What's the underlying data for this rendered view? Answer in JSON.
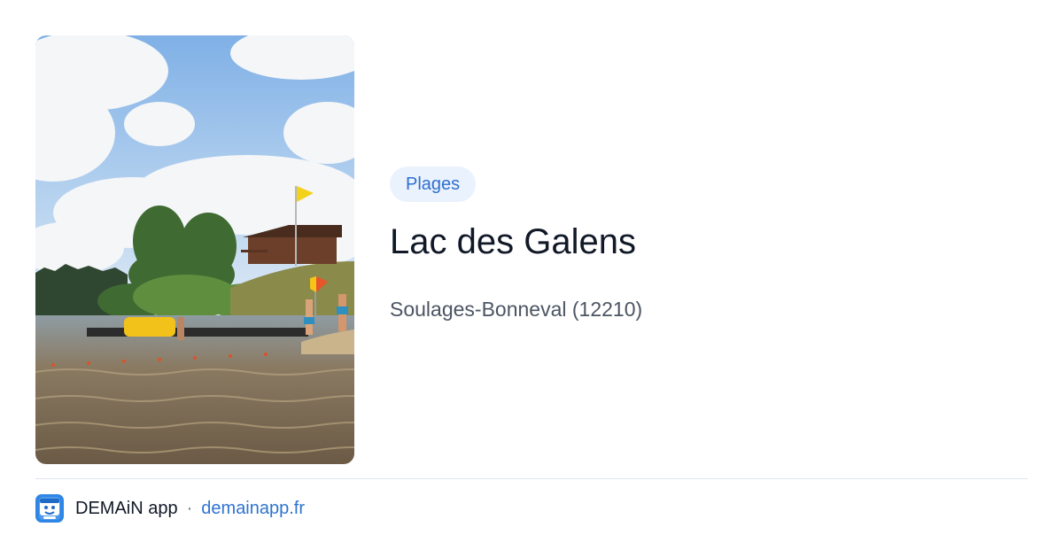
{
  "card": {
    "category": "Plages",
    "title": "Lac des Galens",
    "location": "Soulages-Bonneval (12210)"
  },
  "footer": {
    "app_name": "DEMAiN app",
    "separator": "·",
    "domain": "demainapp.fr"
  },
  "colors": {
    "accent": "#2f74d0",
    "pill_background": "#eaf2fd",
    "title": "#111827",
    "subtitle": "#4b5563",
    "divider": "#dfe5ec"
  },
  "icons": {
    "app_icon": "demain-app-icon"
  }
}
